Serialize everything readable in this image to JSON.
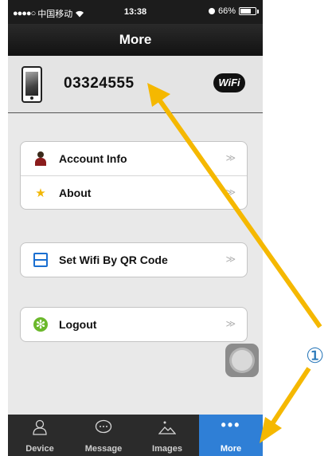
{
  "status_bar": {
    "carrier": "中国移动",
    "signal": "●●●●○",
    "time": "13:38",
    "battery": "66%",
    "battery_level": 0.66
  },
  "nav": {
    "title": "More"
  },
  "device": {
    "id": "03324555",
    "wifi_badge": "WiFi",
    "icon": "phone-icon"
  },
  "menu": {
    "group1": [
      {
        "label": "Account Info",
        "icon": "person-icon",
        "chevron": "≫"
      },
      {
        "label": "About",
        "icon": "star-icon",
        "chevron": "≫"
      }
    ],
    "group2": [
      {
        "label": "Set Wifi By QR Code",
        "icon": "qr-code-icon",
        "chevron": "≫"
      }
    ],
    "group3": [
      {
        "label": "Logout",
        "icon": "logout-icon",
        "chevron": "≫"
      }
    ]
  },
  "tabs": [
    {
      "label": "Device",
      "icon": "person-outline-icon"
    },
    {
      "label": "Message",
      "icon": "chat-bubble-icon"
    },
    {
      "label": "Images",
      "icon": "mountain-icon"
    },
    {
      "label": "More",
      "icon": "more-dots-icon",
      "active": true
    }
  ],
  "annotation": {
    "callout": "①",
    "arrow_color": "#f5b800"
  },
  "colors": {
    "accent": "#2f7fd6",
    "navbar": "#1c1c1c"
  }
}
